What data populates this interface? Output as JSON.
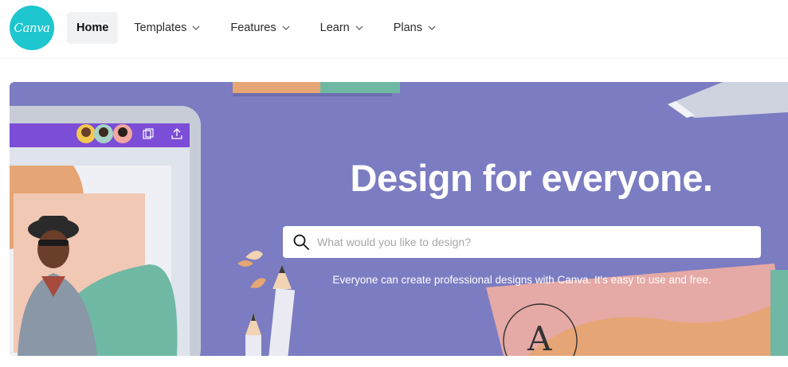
{
  "header": {
    "logo_text": "Canva",
    "nav": [
      {
        "label": "Home",
        "active": true
      },
      {
        "label": "Templates",
        "dropdown": true
      },
      {
        "label": "Features",
        "dropdown": true
      },
      {
        "label": "Learn",
        "dropdown": true
      },
      {
        "label": "Plans",
        "dropdown": true
      }
    ]
  },
  "hero": {
    "title": "Design for everyone.",
    "search_placeholder": "What would you like to design?",
    "subtitle": "Everyone can create professional designs with Canva. It's easy to use and free.",
    "card_letter": "A"
  },
  "colors": {
    "brand": "#1ec6cf",
    "hero_bg": "#7b7cc1",
    "teal": "#6fb8a4",
    "peach": "#e6a574",
    "pink": "#e5a9a6"
  },
  "icons": [
    "search-icon",
    "chevron-down-icon",
    "share-icon",
    "copy-icon"
  ]
}
